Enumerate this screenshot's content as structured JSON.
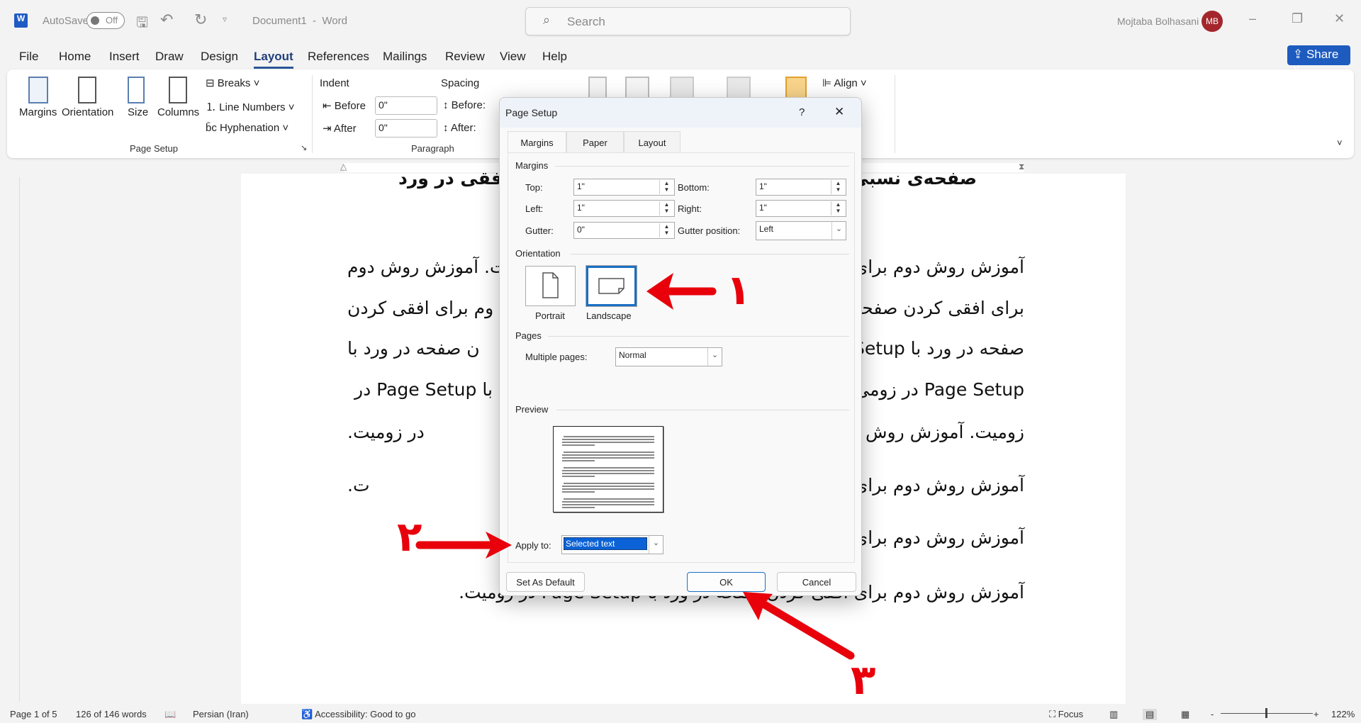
{
  "titlebar": {
    "autosave_label": "AutoSave",
    "autosave_state": "Off",
    "doc_title": "Document1  -  Word",
    "search_placeholder": "Search",
    "user_name": "Mojtaba Bolhasani",
    "user_initials": "MB",
    "avatar_color": "#a4262c"
  },
  "menu": {
    "tabs": [
      "File",
      "Home",
      "Insert",
      "Draw",
      "Design",
      "Layout",
      "References",
      "Mailings",
      "Review",
      "View",
      "Help"
    ],
    "active": "Layout",
    "share_label": "Share"
  },
  "ribbon": {
    "page_setup": {
      "margins": "Margins",
      "orientation": "Orientation",
      "size": "Size",
      "columns": "Columns",
      "breaks": "Breaks",
      "line_numbers": "Line Numbers",
      "hyphenation": "Hyphenation",
      "group_label": "Page Setup"
    },
    "paragraph": {
      "indent_label": "Indent",
      "spacing_label": "Spacing",
      "before_label": "Before",
      "after_label": "After",
      "indent_before": "0\"",
      "indent_after": "0\"",
      "spacing_before": "Before:",
      "spacing_after": "After:",
      "group_label": "Paragraph"
    },
    "arrange": {
      "align": "Align"
    }
  },
  "document": {
    "heading_right": "صفحه‌ی نسبی",
    "heading_left": "افقی در ورد",
    "lines": [
      {
        "right": "آموزش روش دوم برای",
        "left": "ت. آموزش روش دوم"
      },
      {
        "right": "برای افقی کردن صفحه",
        "left": "وم برای افقی کردن"
      },
      {
        "right": "صفحه در ورد با Setup",
        "left": "ن صفحه در ورد با"
      },
      {
        "right": "Page Setup در زومی",
        "left": "با Page Setup در"
      },
      {
        "right": "زومیت. آموزش روش د",
        "left": "در زومیت."
      },
      {
        "right": "آموزش روش دوم برای",
        "left": "ت."
      },
      {
        "right": "آموزش روش دوم برای",
        "left": ""
      },
      {
        "right": "آموزش روش دوم برای افقی کردن صفحه در ورد با Page Setup در زومیت.",
        "left": ""
      }
    ]
  },
  "dialog": {
    "title": "Page Setup",
    "help": "?",
    "close": "✕",
    "tabs": [
      "Margins",
      "Paper",
      "Layout"
    ],
    "active_tab": "Margins",
    "margins_section": "Margins",
    "top_label": "Top:",
    "top": "1\"",
    "bottom_label": "Bottom:",
    "bottom": "1\"",
    "left_label": "Left:",
    "left": "1\"",
    "right_label": "Right:",
    "right": "1\"",
    "gutter_label": "Gutter:",
    "gutter": "0\"",
    "gutter_pos_label": "Gutter position:",
    "gutter_pos": "Left",
    "orientation_section": "Orientation",
    "portrait": "Portrait",
    "landscape": "Landscape",
    "selected_orientation": "Landscape",
    "pages_section": "Pages",
    "multiple_pages_label": "Multiple pages:",
    "multiple_pages": "Normal",
    "preview_section": "Preview",
    "apply_to_label": "Apply to:",
    "apply_to": "Selected text",
    "set_default": "Set As Default",
    "ok": "OK",
    "cancel": "Cancel"
  },
  "annotations": {
    "color": "#e8000b",
    "step1": "۱",
    "step2": "۲",
    "step3": "۳"
  },
  "statusbar": {
    "page": "Page 1 of 5",
    "words": "126 of 146 words",
    "language": "Persian (Iran)",
    "accessibility": "Accessibility: Good to go",
    "focus": "Focus",
    "zoom_minus": "-",
    "zoom_plus": "+",
    "zoom": "122%"
  }
}
